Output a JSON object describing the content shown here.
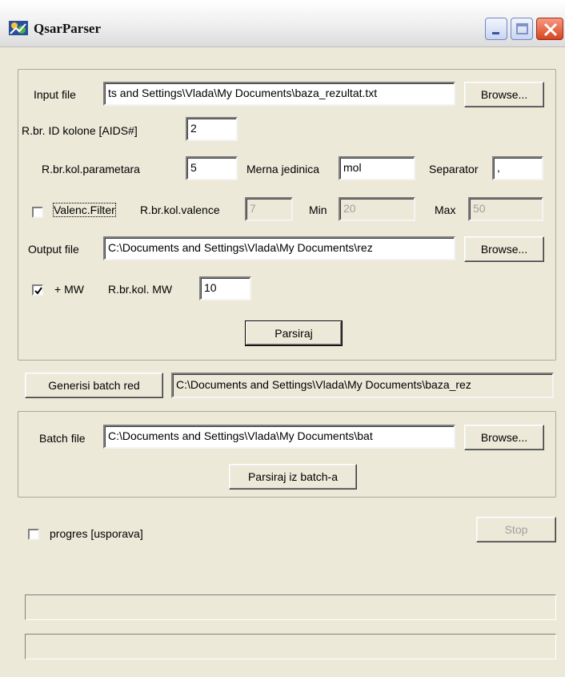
{
  "window": {
    "title": "QsarParser"
  },
  "input_file": {
    "label": "Input file",
    "value": "ts and Settings\\Vlada\\My Documents\\baza_rezultat.txt",
    "browse_label": "Browse..."
  },
  "id_col": {
    "label": "R.br. ID kolone [AIDS#]",
    "value": "2"
  },
  "params": {
    "col_label": "R.br.kol.parametara",
    "col_value": "5",
    "unit_label": "Merna jedinica",
    "unit_value": "mol",
    "sep_label": "Separator",
    "sep_value": ","
  },
  "valence": {
    "filter_label": "Valenc.Filter",
    "checked": false,
    "col_label": "R.br.kol.valence",
    "col_value": "7",
    "min_label": "Min",
    "min_value": "20",
    "max_label": "Max",
    "max_value": "50"
  },
  "output_file": {
    "label": "Output file",
    "value": "C:\\Documents and Settings\\Vlada\\My Documents\\rez",
    "browse_label": "Browse..."
  },
  "mw": {
    "label": "+ MW",
    "checked": true,
    "col_label": "R.br.kol. MW",
    "col_value": "10"
  },
  "parse_button": "Parsiraj",
  "batch_row": {
    "button": "Generisi batch red",
    "value": "C:\\Documents and Settings\\Vlada\\My Documents\\baza_rez"
  },
  "batch_file": {
    "label": "Batch file",
    "value": "C:\\Documents and Settings\\Vlada\\My Documents\\bat",
    "browse_label": "Browse...",
    "parse_button": "Parsiraj iz batch-a"
  },
  "progress": {
    "label": "progres [usporava]",
    "checked": false,
    "stop_label": "Stop"
  },
  "colors": {
    "face": "#ece9d8",
    "disabled_text": "#a0a0a0"
  },
  "icons": [
    "app-icon",
    "minimize-icon",
    "maximize-icon",
    "close-icon",
    "check-icon"
  ]
}
